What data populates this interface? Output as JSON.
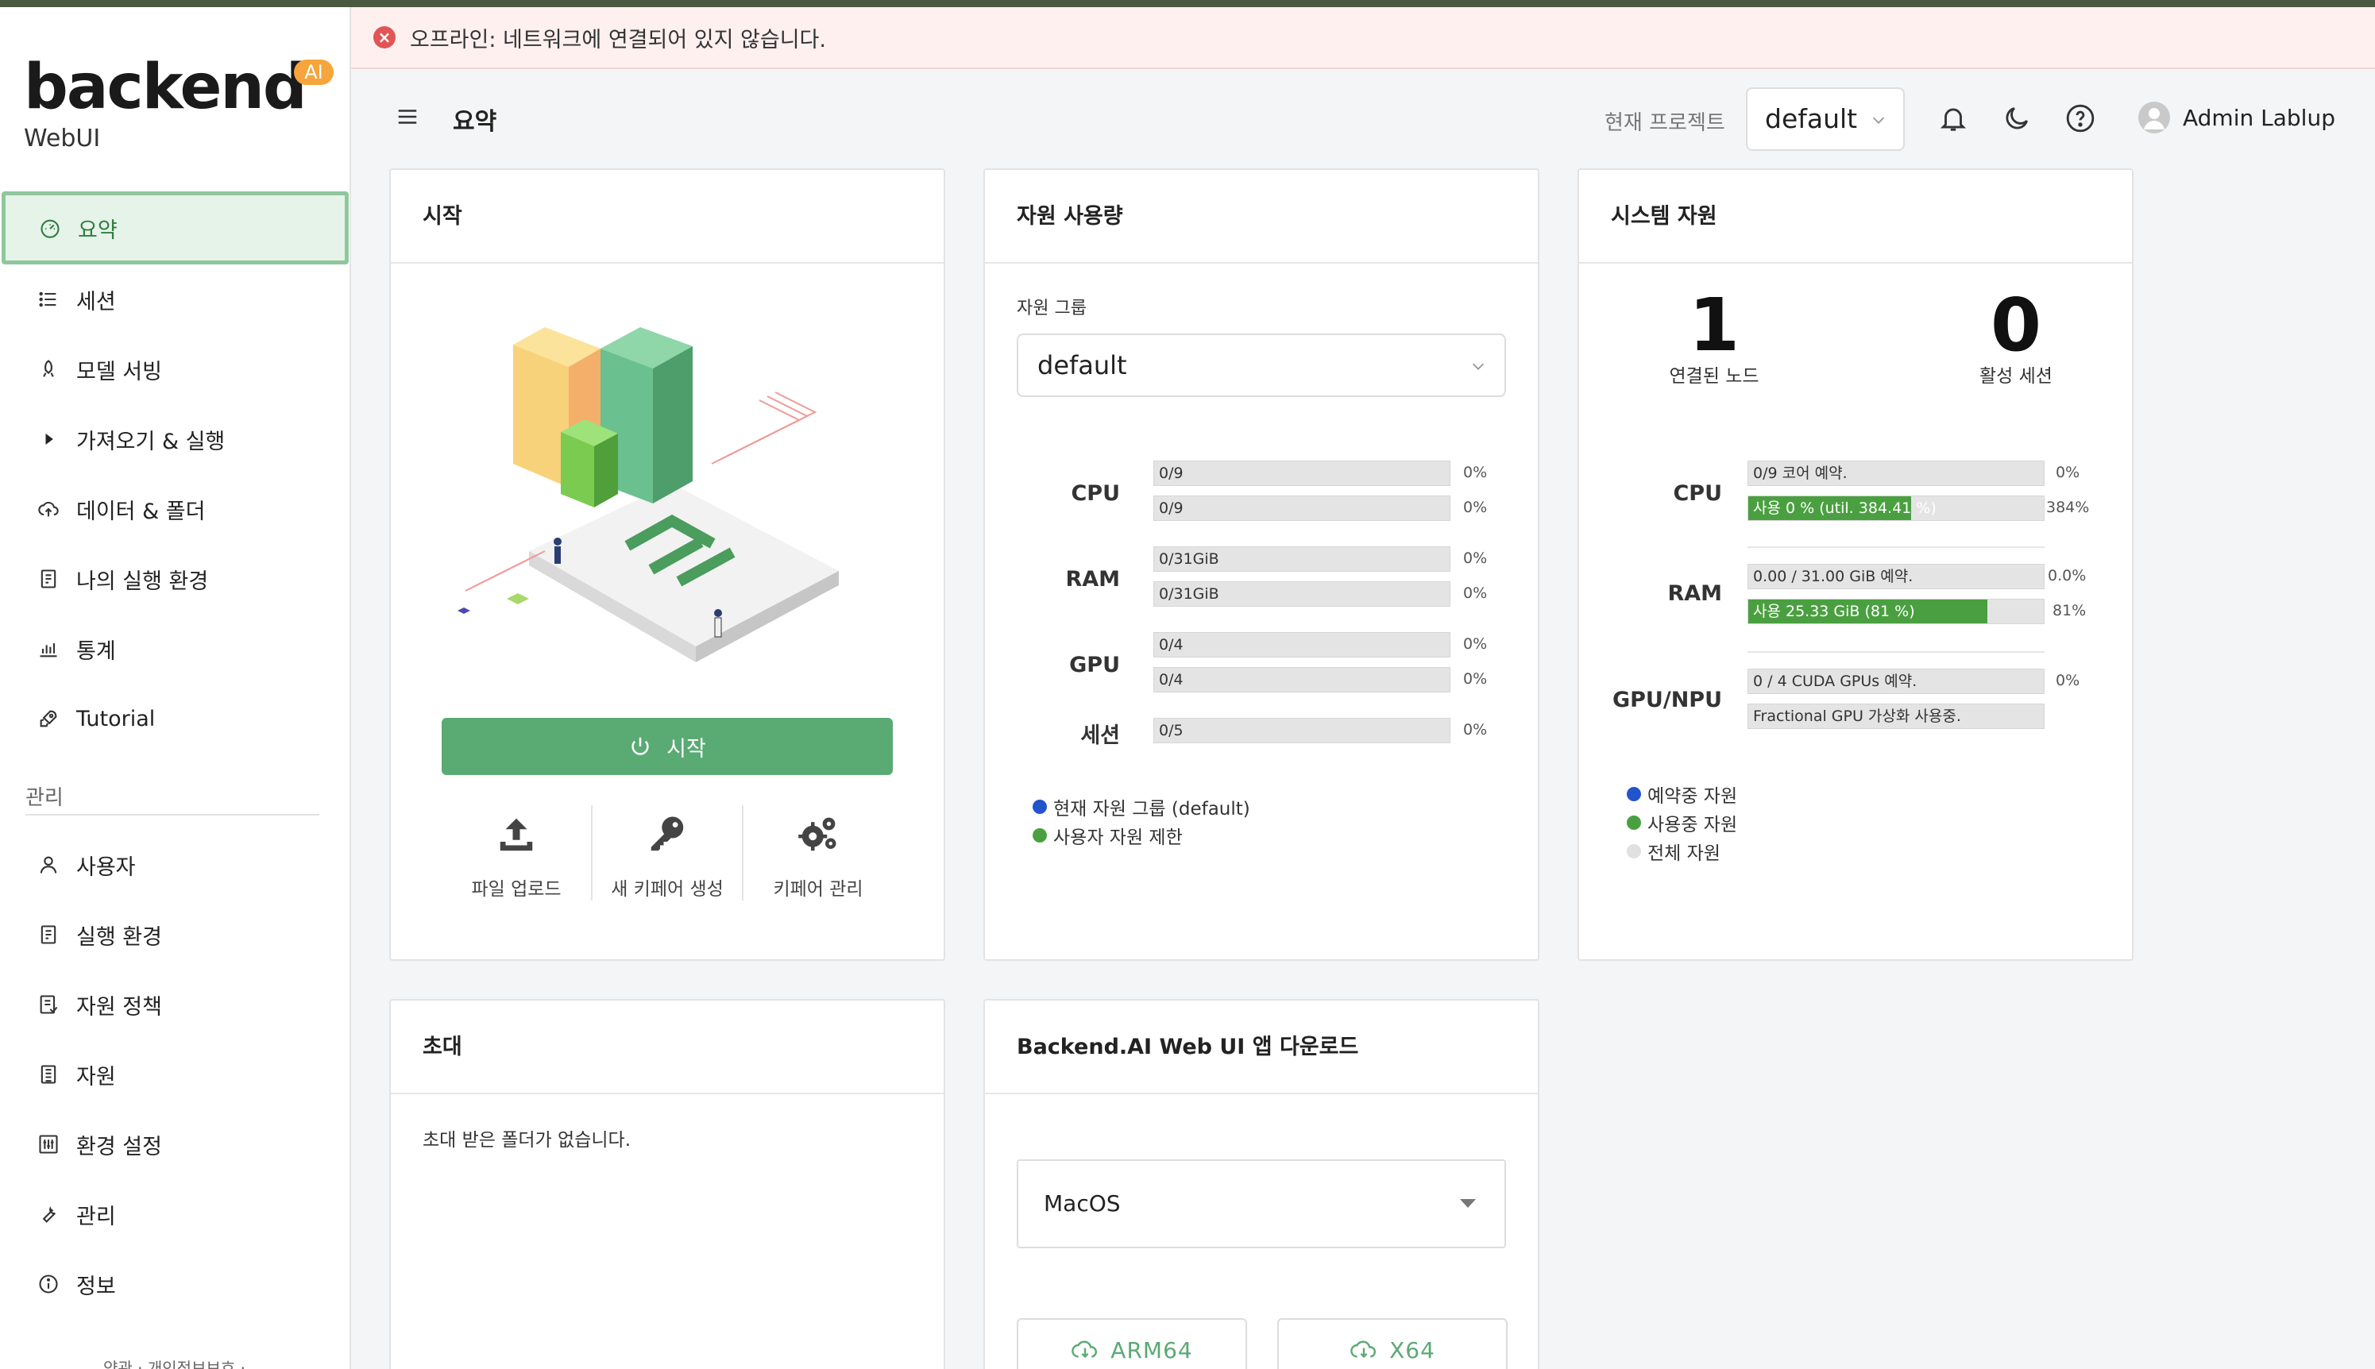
{
  "app": {
    "logo_word": "backend",
    "logo_badge": "AI",
    "logo_sub": "WebUI"
  },
  "banner": {
    "text": "오프라인: 네트워크에 연결되어 있지 않습니다.",
    "icon": "error-icon"
  },
  "sidebar": {
    "items": [
      {
        "label": "요약",
        "icon": "dashboard-icon",
        "active": true
      },
      {
        "label": "세션",
        "icon": "list-icon"
      },
      {
        "label": "모델 서빙",
        "icon": "rocket-icon"
      },
      {
        "label": "가져오기 & 실행",
        "icon": "play-icon"
      },
      {
        "label": "데이터 & 폴더",
        "icon": "cloud-upload-icon"
      },
      {
        "label": "나의 실행 환경",
        "icon": "file-icon"
      },
      {
        "label": "통계",
        "icon": "chart-icon"
      },
      {
        "label": "Tutorial",
        "icon": "rocket-launch-icon"
      }
    ],
    "section_label": "관리",
    "admin_items": [
      {
        "label": "사용자",
        "icon": "user-icon"
      },
      {
        "label": "실행 환경",
        "icon": "file-icon"
      },
      {
        "label": "자원 정책",
        "icon": "policy-icon"
      },
      {
        "label": "자원",
        "icon": "resource-icon"
      },
      {
        "label": "환경 설정",
        "icon": "settings-icon"
      },
      {
        "label": "관리",
        "icon": "wrench-icon"
      },
      {
        "label": "정보",
        "icon": "info-icon"
      }
    ],
    "footer": "약관 · 개인정보보호 ·"
  },
  "header": {
    "title": "요약",
    "project_label": "현재 프로젝트",
    "project_value": "default",
    "username": "Admin Lablup"
  },
  "start_card": {
    "title": "시작",
    "start_button": "시작",
    "actions": [
      {
        "label": "파일 업로드",
        "icon": "upload-icon"
      },
      {
        "label": "새 키페어 생성",
        "icon": "key-icon"
      },
      {
        "label": "키페어 관리",
        "icon": "gears-icon"
      }
    ]
  },
  "usage_card": {
    "title": "자원 사용량",
    "group_label": "자원 그룹",
    "group_value": "default",
    "resources": [
      {
        "label": "CPU",
        "bars": [
          {
            "text": "0/9",
            "pct": "0%",
            "fraction": 0
          },
          {
            "text": "0/9",
            "pct": "0%",
            "fraction": 0
          }
        ]
      },
      {
        "label": "RAM",
        "bars": [
          {
            "text": "0/31GiB",
            "pct": "0%",
            "fraction": 0
          },
          {
            "text": "0/31GiB",
            "pct": "0%",
            "fraction": 0
          }
        ]
      },
      {
        "label": "GPU",
        "bars": [
          {
            "text": "0/4",
            "pct": "0%",
            "fraction": 0
          },
          {
            "text": "0/4",
            "pct": "0%",
            "fraction": 0
          }
        ]
      },
      {
        "label": "세션",
        "bars": [
          {
            "text": "0/5",
            "pct": "0%",
            "fraction": 0
          }
        ]
      }
    ],
    "legend": [
      {
        "label": "현재 자원 그룹 (default)",
        "color": "#2255cc"
      },
      {
        "label": "사용자 자원 제한",
        "color": "#4aa040"
      }
    ]
  },
  "system_card": {
    "title": "시스템 자원",
    "nodes_value": "1",
    "nodes_label": "연결된 노드",
    "sessions_value": "0",
    "sessions_label": "활성 세션",
    "cpu_label": "CPU",
    "cpu_reserved": {
      "text": "0/9 코어 예약.",
      "pct": "0%",
      "fraction": 0
    },
    "cpu_used": {
      "text": "사용 0 % (util. 384.41 %)",
      "pct": "384%",
      "fraction": 0.55
    },
    "ram_label": "RAM",
    "ram_reserved": {
      "text": "0.00 / 31.00 GiB 예약.",
      "pct": "0.0%",
      "fraction": 0
    },
    "ram_used": {
      "text": "사용 25.33 GiB (81 %)",
      "pct": "81%",
      "fraction": 0.81
    },
    "gpu_label": "GPU/NPU",
    "gpu_reserved": {
      "text": "0 / 4 CUDA GPUs 예약.",
      "pct": "0%",
      "fraction": 0
    },
    "gpu_note": "Fractional GPU 가상화 사용중.",
    "legend": [
      {
        "label": "예약중 자원",
        "color": "#2255cc"
      },
      {
        "label": "사용중 자원",
        "color": "#4aa040"
      },
      {
        "label": "전체 자원",
        "color": "#e0e0e0"
      }
    ],
    "bar_color": "#4aa040"
  },
  "invite_card": {
    "title": "초대",
    "empty_text": "초대 받은 폴더가 없습니다."
  },
  "download_card": {
    "title": "Backend.AI Web UI 앱 다운로드",
    "os_value": "MacOS",
    "arm_label": "ARM64",
    "x64_label": "X64"
  }
}
